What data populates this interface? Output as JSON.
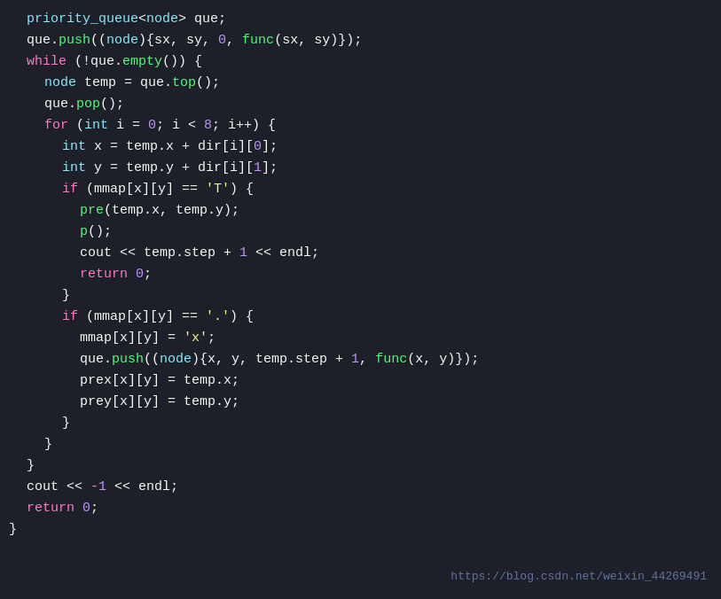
{
  "watermark": "https://blog.csdn.net/weixin_44269491",
  "lines": [
    {
      "indent": 1,
      "tokens": [
        {
          "c": "type",
          "t": "priority_queue"
        },
        {
          "c": "plain",
          "t": "<"
        },
        {
          "c": "type",
          "t": "node"
        },
        {
          "c": "plain",
          "t": "> que;"
        }
      ]
    },
    {
      "indent": 1,
      "tokens": [
        {
          "c": "plain",
          "t": "que."
        },
        {
          "c": "fn",
          "t": "push"
        },
        {
          "c": "plain",
          "t": "(("
        },
        {
          "c": "type",
          "t": "node"
        },
        {
          "c": "plain",
          "t": "){sx, sy, "
        },
        {
          "c": "num",
          "t": "0"
        },
        {
          "c": "plain",
          "t": ", "
        },
        {
          "c": "fn",
          "t": "func"
        },
        {
          "c": "plain",
          "t": "(sx, sy)});"
        }
      ]
    },
    {
      "indent": 1,
      "tokens": [
        {
          "c": "kw",
          "t": "while"
        },
        {
          "c": "plain",
          "t": " (!que."
        },
        {
          "c": "fn",
          "t": "empty"
        },
        {
          "c": "plain",
          "t": "()) {"
        }
      ]
    },
    {
      "indent": 2,
      "tokens": [
        {
          "c": "type",
          "t": "node"
        },
        {
          "c": "plain",
          "t": " temp = que."
        },
        {
          "c": "fn",
          "t": "top"
        },
        {
          "c": "plain",
          "t": "();"
        }
      ]
    },
    {
      "indent": 2,
      "tokens": [
        {
          "c": "plain",
          "t": "que."
        },
        {
          "c": "fn",
          "t": "pop"
        },
        {
          "c": "plain",
          "t": "();"
        }
      ]
    },
    {
      "indent": 2,
      "tokens": [
        {
          "c": "kw",
          "t": "for"
        },
        {
          "c": "plain",
          "t": " ("
        },
        {
          "c": "type",
          "t": "int"
        },
        {
          "c": "plain",
          "t": " i = "
        },
        {
          "c": "num",
          "t": "0"
        },
        {
          "c": "plain",
          "t": "; i < "
        },
        {
          "c": "num",
          "t": "8"
        },
        {
          "c": "plain",
          "t": "; i++) {"
        }
      ]
    },
    {
      "indent": 3,
      "tokens": [
        {
          "c": "type",
          "t": "int"
        },
        {
          "c": "plain",
          "t": " x = temp.x + dir[i]["
        },
        {
          "c": "num",
          "t": "0"
        },
        {
          "c": "plain",
          "t": "];"
        }
      ]
    },
    {
      "indent": 3,
      "tokens": [
        {
          "c": "type",
          "t": "int"
        },
        {
          "c": "plain",
          "t": " y = temp.y + dir[i]["
        },
        {
          "c": "num",
          "t": "1"
        },
        {
          "c": "plain",
          "t": "];"
        }
      ]
    },
    {
      "indent": 3,
      "tokens": [
        {
          "c": "kw",
          "t": "if"
        },
        {
          "c": "plain",
          "t": " (mmap[x][y] == "
        },
        {
          "c": "str",
          "t": "'T'"
        },
        {
          "c": "plain",
          "t": ") {"
        }
      ]
    },
    {
      "indent": 4,
      "tokens": [
        {
          "c": "fn",
          "t": "pre"
        },
        {
          "c": "plain",
          "t": "(temp.x, temp.y);"
        }
      ]
    },
    {
      "indent": 4,
      "tokens": [
        {
          "c": "fn",
          "t": "p"
        },
        {
          "c": "plain",
          "t": "();"
        }
      ]
    },
    {
      "indent": 4,
      "tokens": [
        {
          "c": "plain",
          "t": "cout << temp.step + "
        },
        {
          "c": "num",
          "t": "1"
        },
        {
          "c": "plain",
          "t": " << endl;"
        }
      ]
    },
    {
      "indent": 4,
      "tokens": [
        {
          "c": "kw",
          "t": "return"
        },
        {
          "c": "plain",
          "t": " "
        },
        {
          "c": "num",
          "t": "0"
        },
        {
          "c": "plain",
          "t": ";"
        }
      ]
    },
    {
      "indent": 3,
      "tokens": [
        {
          "c": "plain",
          "t": "}"
        }
      ]
    },
    {
      "indent": 3,
      "tokens": [
        {
          "c": "kw",
          "t": "if"
        },
        {
          "c": "plain",
          "t": " (mmap[x][y] == "
        },
        {
          "c": "str",
          "t": "'.'"
        },
        {
          "c": "plain",
          "t": ") {"
        }
      ]
    },
    {
      "indent": 4,
      "tokens": [
        {
          "c": "plain",
          "t": "mmap[x][y] = "
        },
        {
          "c": "str",
          "t": "'x'"
        },
        {
          "c": "plain",
          "t": ";"
        }
      ]
    },
    {
      "indent": 4,
      "tokens": [
        {
          "c": "plain",
          "t": "que."
        },
        {
          "c": "fn",
          "t": "push"
        },
        {
          "c": "plain",
          "t": "(("
        },
        {
          "c": "type",
          "t": "node"
        },
        {
          "c": "plain",
          "t": "){x, y, temp.step + "
        },
        {
          "c": "num",
          "t": "1"
        },
        {
          "c": "plain",
          "t": ", "
        },
        {
          "c": "fn",
          "t": "func"
        },
        {
          "c": "plain",
          "t": "(x, y)});"
        }
      ]
    },
    {
      "indent": 4,
      "tokens": [
        {
          "c": "plain",
          "t": "prex[x][y] = temp.x;"
        }
      ]
    },
    {
      "indent": 4,
      "tokens": [
        {
          "c": "plain",
          "t": "prey[x][y] = temp.y;"
        }
      ]
    },
    {
      "indent": 3,
      "tokens": [
        {
          "c": "plain",
          "t": "}"
        }
      ]
    },
    {
      "indent": 2,
      "tokens": [
        {
          "c": "plain",
          "t": "}"
        }
      ]
    },
    {
      "indent": 1,
      "tokens": [
        {
          "c": "plain",
          "t": "}"
        }
      ]
    },
    {
      "indent": 1,
      "tokens": [
        {
          "c": "plain",
          "t": "cout << "
        },
        {
          "c": "op",
          "t": "-"
        },
        {
          "c": "num",
          "t": "1"
        },
        {
          "c": "plain",
          "t": " << endl;"
        }
      ]
    },
    {
      "indent": 1,
      "tokens": [
        {
          "c": "kw",
          "t": "return"
        },
        {
          "c": "plain",
          "t": " "
        },
        {
          "c": "num",
          "t": "0"
        },
        {
          "c": "plain",
          "t": ";"
        }
      ]
    },
    {
      "indent": 0,
      "tokens": [
        {
          "c": "plain",
          "t": "}"
        }
      ]
    }
  ]
}
